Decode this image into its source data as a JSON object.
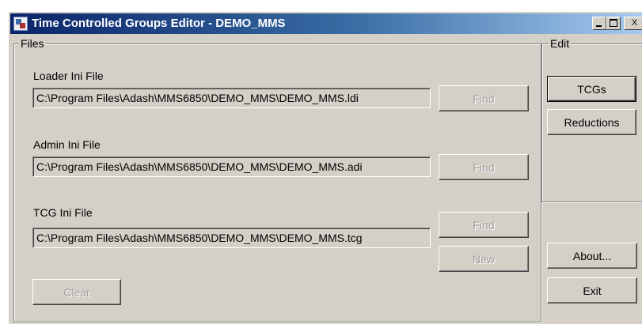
{
  "window": {
    "title": "Time Controlled Groups Editor - DEMO_MMS",
    "minimize_label": "",
    "maximize_label": "",
    "close_label": "X"
  },
  "files": {
    "group_label": "Files",
    "loader": {
      "label": "Loader Ini File",
      "value": "C:\\Program Files\\Adash\\MMS6850\\DEMO_MMS\\DEMO_MMS.ldi",
      "find_label": "Find"
    },
    "admin": {
      "label": "Admin Ini File",
      "value": "C:\\Program Files\\Adash\\MMS6850\\DEMO_MMS\\DEMO_MMS.adi",
      "find_label": "Find"
    },
    "tcg": {
      "label": "TCG Ini File",
      "value": "C:\\Program Files\\Adash\\MMS6850\\DEMO_MMS\\DEMO_MMS.tcg",
      "find_label": "Find",
      "new_label": "New"
    },
    "clear_label": "Clear"
  },
  "edit": {
    "group_label": "Edit",
    "tcgs_label": "TCGs",
    "reductions_label": "Reductions"
  },
  "actions": {
    "about_label": "About...",
    "exit_label": "Exit"
  }
}
